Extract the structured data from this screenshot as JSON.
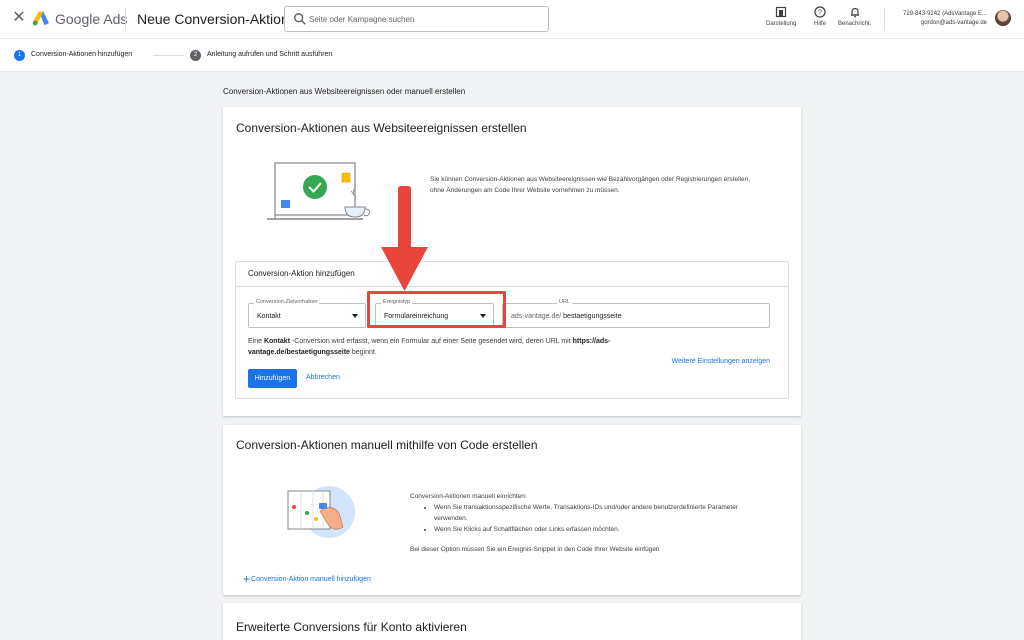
{
  "topbar": {
    "brand": "Google Ads",
    "page_title": "Neue Conversion-Aktion",
    "search_placeholder": "Seite oder Kampagne suchen",
    "tools": [
      {
        "label": "Darstellung",
        "icon": "appearance-icon"
      },
      {
        "label": "Hilfe",
        "icon": "help-icon"
      },
      {
        "label": "Benachricht.",
        "icon": "bell-icon"
      }
    ],
    "account_line1": "729-843-9242 (AdsVantage E...",
    "account_line2": "gordon@ads-vantage.de"
  },
  "stepper": {
    "steps": [
      {
        "number": "1",
        "label": "Conversion-Aktionen hinzufügen",
        "active": true
      },
      {
        "number": "2",
        "label": "Anleitung aufrufen und Schritt ausführen",
        "active": false
      }
    ]
  },
  "main": {
    "heading": "Conversion-Aktionen aus Websiteereignissen oder manuell erstellen",
    "website_card": {
      "title": "Conversion-Aktionen aus Websiteereignissen erstellen",
      "description": "Sie können Conversion-Aktionen aus Websiteereignissen wie Bezahlvorgängen oder Registrierungen erstellen, ohne Änderungen am Code Ihrer Website vornehmen zu müssen.",
      "form": {
        "title": "Conversion-Aktion hinzufügen",
        "goal_label": "Conversion-Zielvorhaben",
        "goal_value": "Kontakt",
        "event_label": "Ereignistyp",
        "event_value": "Formulareinreichung",
        "url_label": "URL",
        "url_prefix": "ads-vantage.de/",
        "url_value": "bestaetigungsseite",
        "explain_1": "Eine ",
        "explain_bold_1": "Kontakt",
        "explain_2": " -Conversion wird erfasst, wenn ein Formular auf einer Seite gesendet wird, deren URL mit ",
        "explain_bold_2": "https://ads-vantage.de/bestaetigungsseite",
        "explain_3": " beginnt.",
        "more_settings": "Weitere Einstellungen anzeigen",
        "add_button": "Hinzufügen",
        "cancel_button": "Abbrechen"
      }
    },
    "manual_card": {
      "title": "Conversion-Aktionen manuell mithilfe von Code erstellen",
      "intro": "Conversion-Aktionen manuell einrichten:",
      "bullets": [
        "Wenn Sie transaktionsspezifische Werte, Transaktions-IDs und/oder andere benutzerdefinierte Parameter verwenden.",
        "Wenn Sie Klicks auf Schaltflächen oder Links erfassen möchten."
      ],
      "note": "Bei dieser Option müssen Sie ein Ereignis-Snippet in den Code Ihrer Website einfügen",
      "add_link": "Conversion-Aktion manuell hinzufügen"
    },
    "enhanced_card": {
      "title": "Erweiterte Conversions für Konto aktivieren"
    }
  },
  "colors": {
    "accent": "#1a73e8",
    "highlight": "#e8453c",
    "check_green": "#34a853"
  }
}
